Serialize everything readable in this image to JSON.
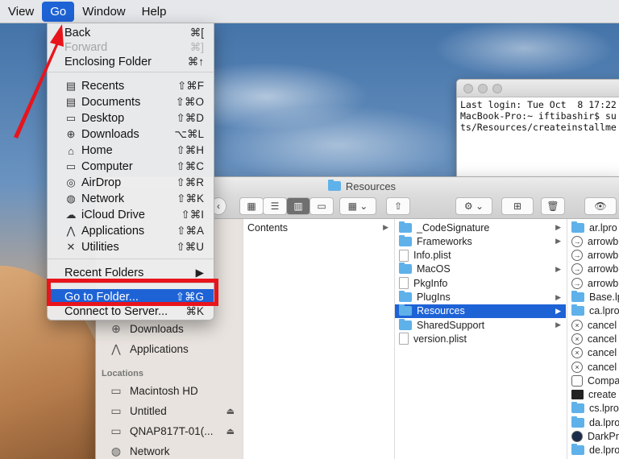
{
  "menubar": {
    "items": [
      "View",
      "Go",
      "Window",
      "Help"
    ]
  },
  "go_menu": {
    "items": [
      {
        "label": "Back",
        "shortcut": "⌘["
      },
      {
        "label": "Forward",
        "shortcut": "⌘]",
        "disabled": true
      },
      {
        "label": "Enclosing Folder",
        "shortcut": "⌘↑"
      },
      {
        "label": "Recents",
        "shortcut": "⇧⌘F",
        "icon": "recents-icon"
      },
      {
        "label": "Documents",
        "shortcut": "⇧⌘O",
        "icon": "documents-icon"
      },
      {
        "label": "Desktop",
        "shortcut": "⇧⌘D",
        "icon": "desktop-icon"
      },
      {
        "label": "Downloads",
        "shortcut": "⌥⌘L",
        "icon": "downloads-icon"
      },
      {
        "label": "Home",
        "shortcut": "⇧⌘H",
        "icon": "home-icon"
      },
      {
        "label": "Computer",
        "shortcut": "⇧⌘C",
        "icon": "computer-icon"
      },
      {
        "label": "AirDrop",
        "shortcut": "⇧⌘R",
        "icon": "airdrop-icon"
      },
      {
        "label": "Network",
        "shortcut": "⇧⌘K",
        "icon": "network-icon"
      },
      {
        "label": "iCloud Drive",
        "shortcut": "⇧⌘I",
        "icon": "icloud-icon"
      },
      {
        "label": "Applications",
        "shortcut": "⇧⌘A",
        "icon": "applications-icon"
      },
      {
        "label": "Utilities",
        "shortcut": "⇧⌘U",
        "icon": "utilities-icon"
      },
      {
        "label": "Recent Folders",
        "shortcut": "▶"
      },
      {
        "label": "Go to Folder...",
        "shortcut": "⇧⌘G",
        "highlighted": true
      },
      {
        "label": "Connect to Server...",
        "shortcut": "⌘K"
      }
    ]
  },
  "terminal": {
    "lines": [
      "Last login: Tue Oct  8 17:22",
      "MacBook-Pro:~ iftibashir$ su",
      "ts/Resources/createinstallme"
    ]
  },
  "finder": {
    "title": "Resources",
    "sidebar": {
      "items": [
        "Downloads",
        "Applications"
      ],
      "locations_header": "Locations",
      "locations": [
        "Macintosh HD",
        "Untitled",
        "QNAP817T-01(...",
        "Network"
      ]
    },
    "col1": [
      "Contents"
    ],
    "col2": [
      {
        "name": "_CodeSignature",
        "type": "folder",
        "chevron": true
      },
      {
        "name": "Frameworks",
        "type": "folder",
        "chevron": true
      },
      {
        "name": "Info.plist",
        "type": "doc"
      },
      {
        "name": "MacOS",
        "type": "folder",
        "chevron": true
      },
      {
        "name": "PkgInfo",
        "type": "doc"
      },
      {
        "name": "PlugIns",
        "type": "folder",
        "chevron": true
      },
      {
        "name": "Resources",
        "type": "folder",
        "chevron": true,
        "selected": true
      },
      {
        "name": "SharedSupport",
        "type": "folder",
        "chevron": true
      },
      {
        "name": "version.plist",
        "type": "doc"
      }
    ],
    "col3": [
      {
        "name": "ar.lpro",
        "type": "folder"
      },
      {
        "name": "arrowb",
        "type": "circle",
        "glyph": "→"
      },
      {
        "name": "arrowb",
        "type": "circle",
        "glyph": "→"
      },
      {
        "name": "arrowb",
        "type": "circle",
        "glyph": "→"
      },
      {
        "name": "arrowb",
        "type": "circle",
        "glyph": "→"
      },
      {
        "name": "Base.lp",
        "type": "folder"
      },
      {
        "name": "ca.lpro",
        "type": "folder"
      },
      {
        "name": "cancel",
        "type": "circle",
        "glyph": "×"
      },
      {
        "name": "cancel",
        "type": "circle",
        "glyph": "×"
      },
      {
        "name": "cancel",
        "type": "circle",
        "glyph": "×"
      },
      {
        "name": "cancel",
        "type": "circle",
        "glyph": "×"
      },
      {
        "name": "Compa",
        "type": "shield"
      },
      {
        "name": "create",
        "type": "exec"
      },
      {
        "name": "cs.lpro",
        "type": "folder"
      },
      {
        "name": "da.lpro",
        "type": "folder"
      },
      {
        "name": "DarkPr",
        "type": "dark"
      },
      {
        "name": "de.lpro",
        "type": "folder"
      }
    ]
  }
}
